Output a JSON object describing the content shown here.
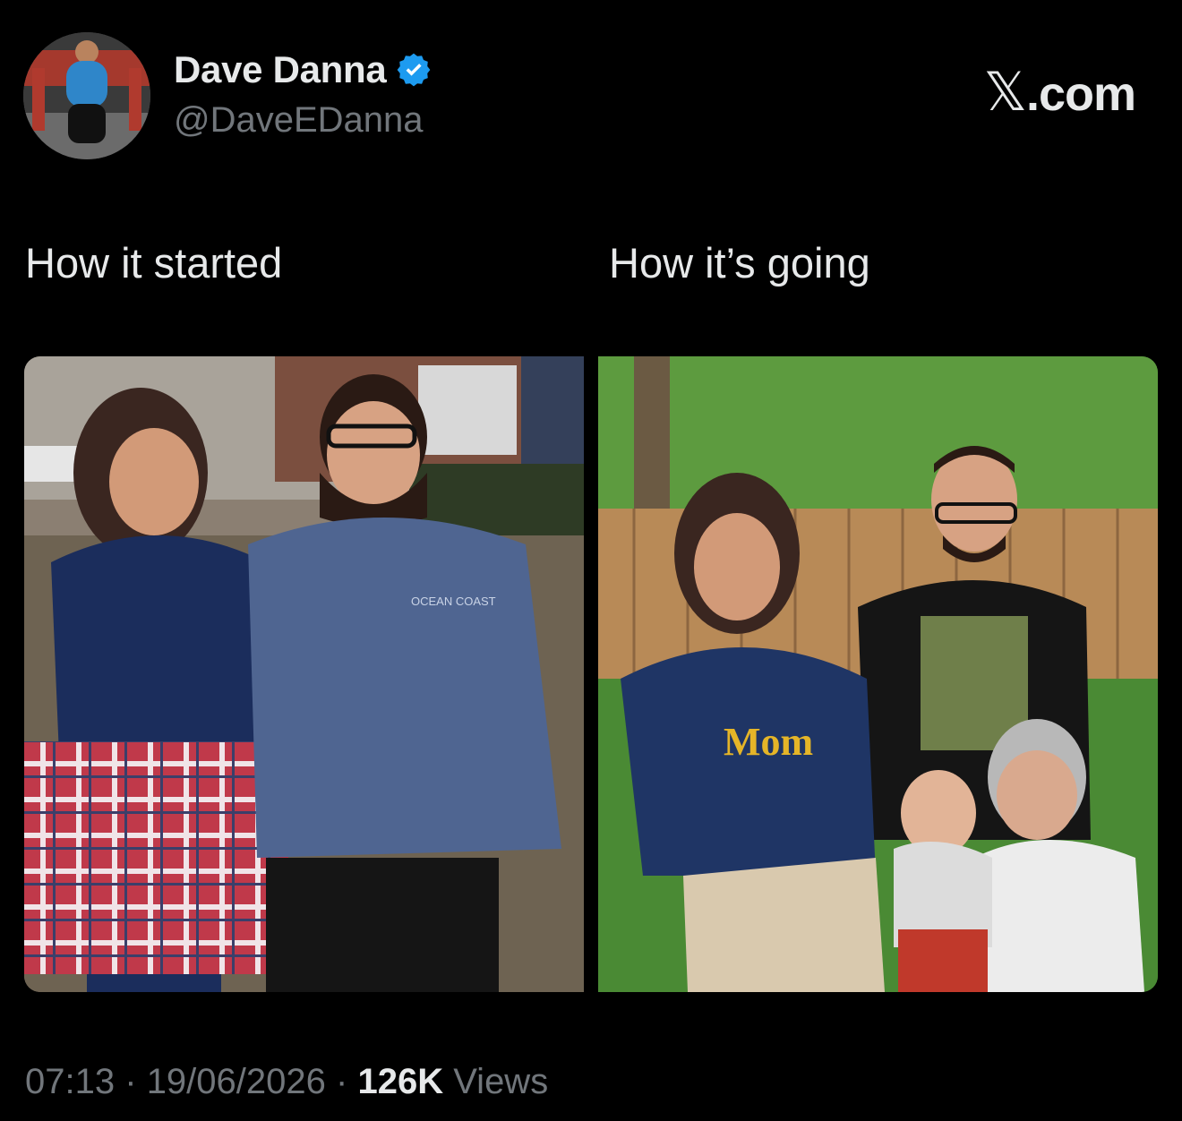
{
  "author": {
    "name": "Dave Danna",
    "handle": "@DaveEDanna",
    "verified_color": "#1d9bf0"
  },
  "brand": {
    "text": ".com",
    "glyph": "𝕏"
  },
  "captions": {
    "left": "How it started",
    "right": "How it’s going"
  },
  "images": {
    "left": {
      "shirt_text": "OCEAN COAST"
    },
    "right": {
      "shirt_text": "Mom"
    }
  },
  "footer": {
    "time": "07:13",
    "date": "19/06/2026",
    "views_count": "126K",
    "views_label": "Views",
    "sep": "·"
  }
}
